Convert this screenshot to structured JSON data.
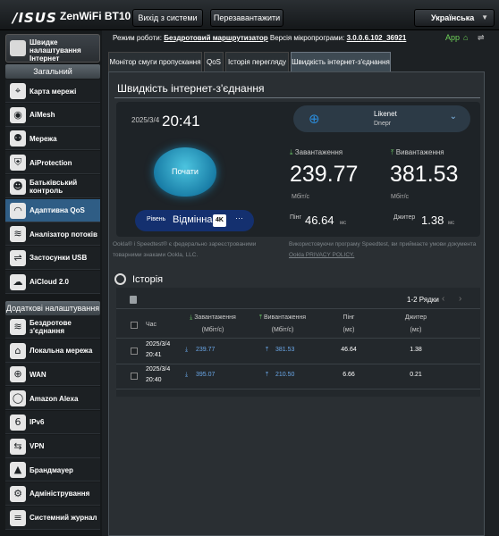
{
  "topbar": {
    "logo": "/ISUS",
    "model": "ZenWiFi BT10",
    "logout_label": "Вихід з системи",
    "reboot_label": "Перезавантажити",
    "language": "Українська"
  },
  "sidebar": {
    "quick_setup": "Швидке налаштування Інтернет",
    "general_header": "Загальний",
    "general_items": [
      {
        "label": "Карта мережі",
        "icon": "map-icon"
      },
      {
        "label": "AiMesh",
        "icon": "aimesh-icon"
      },
      {
        "label": "Мережа",
        "icon": "network-icon"
      },
      {
        "label": "AiProtection",
        "icon": "shield-icon"
      },
      {
        "label": "Батьківський контроль",
        "icon": "parental-icon"
      },
      {
        "label": "Адаптивна QoS",
        "icon": "qos-icon"
      },
      {
        "label": "Аналізатор потоків",
        "icon": "traffic-icon"
      },
      {
        "label": "Застосунки USB",
        "icon": "usb-icon"
      },
      {
        "label": "AiCloud 2.0",
        "icon": "cloud-icon"
      }
    ],
    "advanced_header": "Додаткові налаштування",
    "advanced_items": [
      {
        "label": "Бездротове з'єднання",
        "icon": "wireless-icon"
      },
      {
        "label": "Локальна мережа",
        "icon": "lan-icon"
      },
      {
        "label": "WAN",
        "icon": "wan-icon"
      },
      {
        "label": "Amazon Alexa",
        "icon": "alexa-icon"
      },
      {
        "label": "IPv6",
        "icon": "ipv6-icon"
      },
      {
        "label": "VPN",
        "icon": "vpn-icon"
      },
      {
        "label": "Брандмауер",
        "icon": "firewall-icon"
      },
      {
        "label": "Адміністрування",
        "icon": "admin-icon"
      },
      {
        "label": "Системний журнал",
        "icon": "log-icon"
      }
    ]
  },
  "status": {
    "mode_label": "Режим роботи:",
    "mode_value": "Бездротовий маршрутизатор",
    "fw_label": "Версія мікропрограми:",
    "fw_value": "3.0.0.6.102_36921",
    "app_label": "App"
  },
  "tabs": [
    "Монітор смуги пропускання",
    "QoS",
    "Історія перегляду",
    "Швидкість інтернет-з'єднання"
  ],
  "speedtest": {
    "title": "Швидкість інтернет-з'єднання",
    "date": "2025/3/4",
    "time": "20:41",
    "go_label": "Почати",
    "server_name": "Likenet",
    "server_city": "Dnepr",
    "download_label": "Завантаження",
    "upload_label": "Вивантаження",
    "download_value": "239.77",
    "upload_value": "381.53",
    "unit": "Мбіт/с",
    "rating_label": "Рівень",
    "rating_value": "Відмінна",
    "rating_badge": "4K",
    "rating_more": "···",
    "ping_label": "Пінг",
    "ping_value": "46.64",
    "ping_unit": "мс",
    "jitter_label": "Джитер",
    "jitter_value": "1.38",
    "jitter_unit": "мс",
    "note_left_1": "Ookla® і Speedtest® є федерально зареєстрованими",
    "note_left_2": "товарними знаками Ookla, LLC.",
    "note_right_1": "Використовуючи програму Speedtest, ви приймаєте умови документа",
    "note_right_2": "Ookla PRIVACY POLICY."
  },
  "history": {
    "title": "Історія",
    "pager": "1-2 Рядки",
    "headers": {
      "time": "Час",
      "download": "Завантаження",
      "download_unit": "(Мбіт/с)",
      "upload": "Вивантаження",
      "upload_unit": "(Мбіт/с)",
      "ping": "Пінг",
      "ping_unit": "(мс)",
      "jitter": "Джитер",
      "jitter_unit": "(мс)"
    },
    "rows": [
      {
        "date": "2025/3/4",
        "time": "20:41",
        "download": "239.77",
        "upload": "381.53",
        "ping": "46.64",
        "jitter": "1.38"
      },
      {
        "date": "2025/3/4",
        "time": "20:40",
        "download": "395.07",
        "upload": "210.50",
        "ping": "6.66",
        "jitter": "0.21"
      }
    ]
  },
  "colors": {
    "accent": "#2f5d85",
    "download_arrow": "#68c064",
    "history_value": "#6aa7e8"
  }
}
